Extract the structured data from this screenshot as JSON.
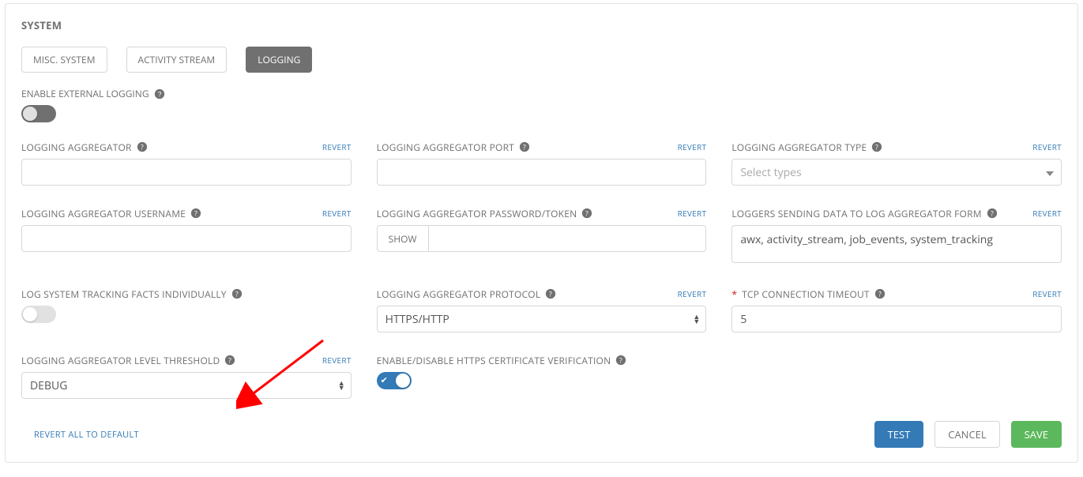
{
  "panel_title": "SYSTEM",
  "tabs": {
    "misc": "MISC. SYSTEM",
    "activity": "ACTIVITY STREAM",
    "logging": "LOGGING"
  },
  "enable_external_logging": {
    "label": "ENABLE EXTERNAL LOGGING"
  },
  "revert_label": "REVERT",
  "fields": {
    "aggregator": {
      "label": "LOGGING AGGREGATOR",
      "value": ""
    },
    "port": {
      "label": "LOGGING AGGREGATOR PORT",
      "value": ""
    },
    "type": {
      "label": "LOGGING AGGREGATOR TYPE",
      "placeholder": "Select types",
      "value": ""
    },
    "username": {
      "label": "LOGGING AGGREGATOR USERNAME",
      "value": ""
    },
    "password": {
      "label": "LOGGING AGGREGATOR PASSWORD/TOKEN",
      "show_btn": "SHOW",
      "value": ""
    },
    "loggers_form": {
      "label": "LOGGERS SENDING DATA TO LOG AGGREGATOR FORM",
      "value": "awx, activity_stream, job_events, system_tracking"
    },
    "track_facts": {
      "label": "LOG SYSTEM TRACKING FACTS INDIVIDUALLY"
    },
    "protocol": {
      "label": "LOGGING AGGREGATOR PROTOCOL",
      "value": "HTTPS/HTTP"
    },
    "tcp_timeout": {
      "label": "TCP CONNECTION TIMEOUT",
      "value": "5"
    },
    "level_threshold": {
      "label": "LOGGING AGGREGATOR LEVEL THRESHOLD",
      "value": "DEBUG"
    },
    "https_verify": {
      "label": "ENABLE/DISABLE HTTPS CERTIFICATE VERIFICATION"
    }
  },
  "footer": {
    "revert_all": "REVERT ALL TO DEFAULT",
    "test": "TEST",
    "cancel": "CANCEL",
    "save": "SAVE"
  }
}
